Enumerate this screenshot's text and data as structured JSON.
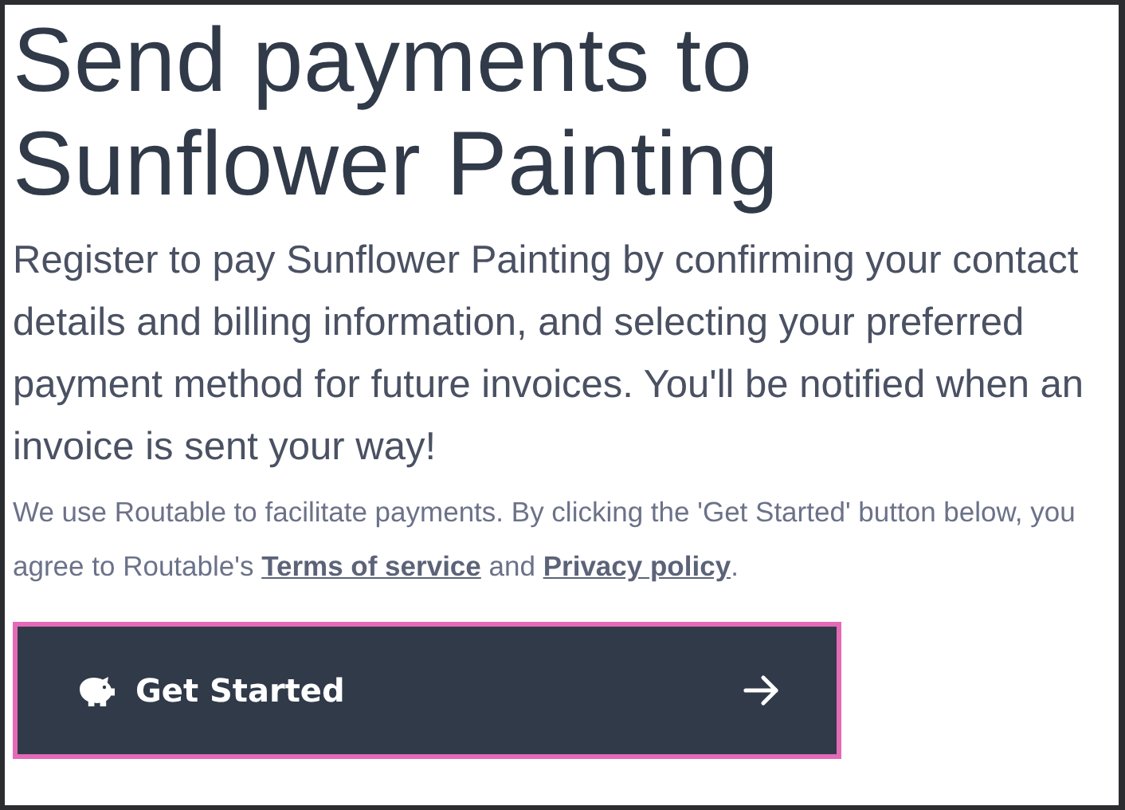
{
  "heading": "Send payments to Sunflower Painting",
  "intro": "Register to pay Sunflower Painting by confirming your contact details and billing information, and selecting your preferred payment method for future invoices. You'll be notified when an invoice is sent your way!",
  "notice": {
    "text_before": "We use Routable to facilitate payments. By clicking the 'Get Started' button below, you agree to Routable's ",
    "terms_link": "Terms of service",
    "text_middle": " and ",
    "privacy_link": "Privacy policy",
    "text_after": "."
  },
  "button": {
    "label": "Get Started",
    "focused": true
  }
}
